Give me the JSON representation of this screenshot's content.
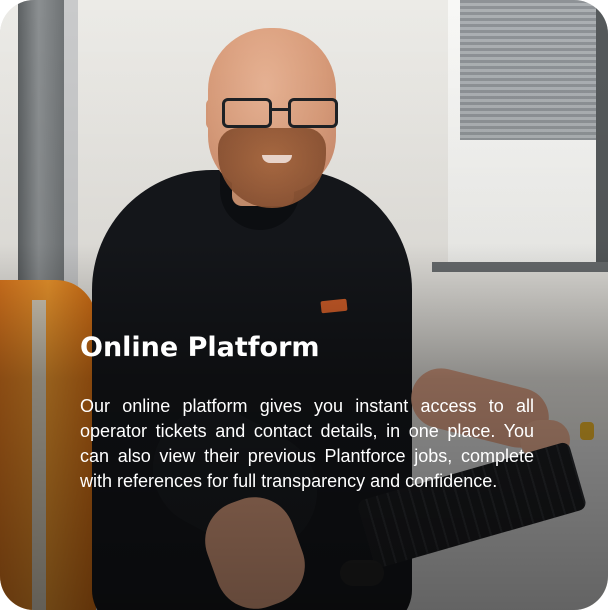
{
  "card": {
    "title": "Online Platform",
    "description": "Our online platform gives you instant access to all operator tickets and contact details, in one place. You can also view their previous Plantforce jobs, complete with references for full transparency and confidence."
  },
  "colors": {
    "text": "#ffffff",
    "shirt": "#15171b",
    "chair_orange": "#f39a2e",
    "badge": "#d9622b"
  },
  "icons": []
}
